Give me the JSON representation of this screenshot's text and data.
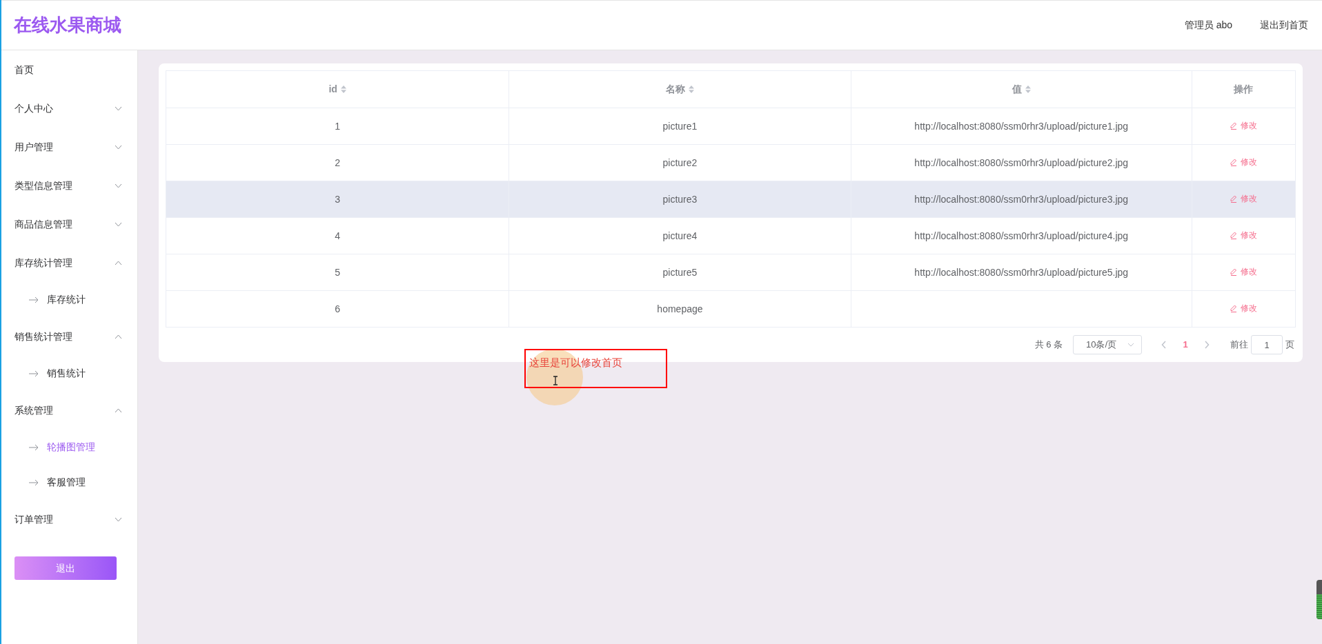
{
  "header": {
    "title": "在线水果商城",
    "user": "管理员 abo",
    "exit_link": "退出到首页"
  },
  "sidebar": {
    "items": [
      {
        "label": "首页",
        "kind": "link"
      },
      {
        "label": "个人中心",
        "kind": "group",
        "expanded": false
      },
      {
        "label": "用户管理",
        "kind": "group",
        "expanded": false
      },
      {
        "label": "类型信息管理",
        "kind": "group",
        "expanded": false
      },
      {
        "label": "商品信息管理",
        "kind": "group",
        "expanded": false
      },
      {
        "label": "库存统计管理",
        "kind": "group",
        "expanded": true,
        "children": [
          {
            "label": "库存统计",
            "selected": false
          }
        ]
      },
      {
        "label": "销售统计管理",
        "kind": "group",
        "expanded": true,
        "children": [
          {
            "label": "销售统计",
            "selected": false
          }
        ]
      },
      {
        "label": "系统管理",
        "kind": "group",
        "expanded": true,
        "children": [
          {
            "label": "轮播图管理",
            "selected": true
          },
          {
            "label": "客服管理",
            "selected": false
          }
        ]
      },
      {
        "label": "订单管理",
        "kind": "group",
        "expanded": false
      }
    ],
    "logout": "退出"
  },
  "table": {
    "columns": [
      {
        "label": "id",
        "sortable": true
      },
      {
        "label": "名称",
        "sortable": true
      },
      {
        "label": "值",
        "sortable": true
      },
      {
        "label": "操作",
        "sortable": false
      }
    ],
    "rows": [
      {
        "cells": [
          "1",
          "picture1",
          "http://localhost:8080/ssm0rhr3/upload/picture1.jpg"
        ],
        "action": "修改",
        "highlighted": false
      },
      {
        "cells": [
          "2",
          "picture2",
          "http://localhost:8080/ssm0rhr3/upload/picture2.jpg"
        ],
        "action": "修改",
        "highlighted": false
      },
      {
        "cells": [
          "3",
          "picture3",
          "http://localhost:8080/ssm0rhr3/upload/picture3.jpg"
        ],
        "action": "修改",
        "highlighted": true
      },
      {
        "cells": [
          "4",
          "picture4",
          "http://localhost:8080/ssm0rhr3/upload/picture4.jpg"
        ],
        "action": "修改",
        "highlighted": false
      },
      {
        "cells": [
          "5",
          "picture5",
          "http://localhost:8080/ssm0rhr3/upload/picture5.jpg"
        ],
        "action": "修改",
        "highlighted": false
      },
      {
        "cells": [
          "6",
          "homepage",
          ""
        ],
        "action": "修改",
        "highlighted": false
      }
    ]
  },
  "pagination": {
    "total": "共 6 条",
    "page_size": "10条/页",
    "pages": [
      {
        "label": "1",
        "selected": true
      }
    ],
    "goto_label": "前往",
    "goto_value": "1",
    "goto_suffix": "页"
  },
  "annotation": {
    "text": "这里是可以修改首页"
  }
}
